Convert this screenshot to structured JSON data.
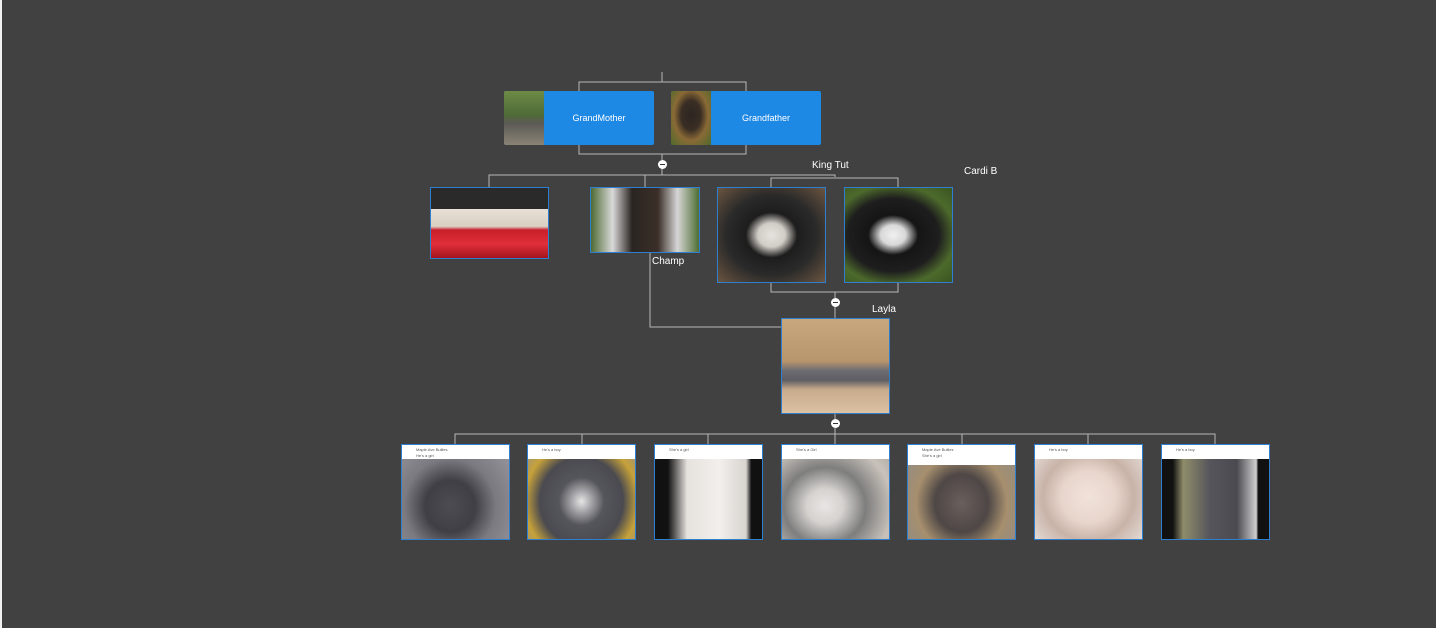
{
  "tree": {
    "grandmother": {
      "label": "GrandMother"
    },
    "grandfather": {
      "label": "Grandfather"
    },
    "king_tut": {
      "label": "King Tut"
    },
    "cardi_b": {
      "label": "Cardi B"
    },
    "champ": {
      "label": "Champ"
    },
    "layla": {
      "label": "Layla"
    },
    "puppies": [
      {
        "caption1": "Maple Ave Bullies",
        "caption2": "He's a girl"
      },
      {
        "caption1": "",
        "caption2": "He's a boy"
      },
      {
        "caption1": "",
        "caption2": "She's a girl"
      },
      {
        "caption1": "",
        "caption2": "She's a Girl"
      },
      {
        "caption1": "Maple Ave Bullies",
        "caption2": "She's a girl"
      },
      {
        "caption1": "",
        "caption2": "He's a boy"
      },
      {
        "caption1": "",
        "caption2": "He's a boy"
      }
    ]
  },
  "colors": {
    "background": "#414141",
    "card": "#1e88e5",
    "node_border": "#2f7fd0",
    "connector": "#b8b8b8"
  },
  "icons": {
    "collapse": "minus-circle-icon"
  }
}
